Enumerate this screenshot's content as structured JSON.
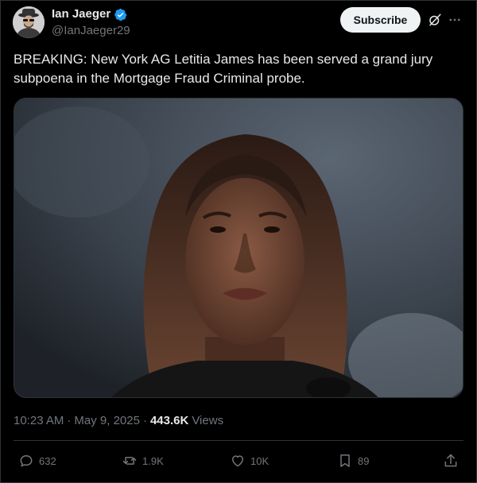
{
  "author": {
    "name": "Ian Jaeger",
    "handle": "@IanJaeger29",
    "verified": true
  },
  "header": {
    "subscribe_label": "Subscribe"
  },
  "tweet": {
    "text": "BREAKING: New York AG Letitia James has been served a grand jury subpoena in the Mortgage Fraud Criminal probe.",
    "time": "10:23 AM",
    "separator": "·",
    "date": "May 9, 2025",
    "views_count": "443.6K",
    "views_label": "Views"
  },
  "actions": {
    "replies": "632",
    "reposts": "1.9K",
    "likes": "10K",
    "bookmarks": "89"
  },
  "colors": {
    "background": "#000000",
    "text_primary": "#e7e9ea",
    "text_secondary": "#71767b",
    "border": "#2f3336",
    "verified": "#1d9bf0",
    "button_bg": "#eff3f4"
  }
}
